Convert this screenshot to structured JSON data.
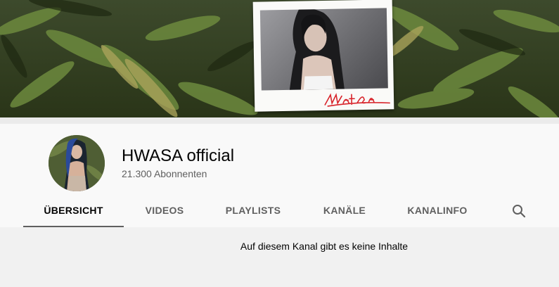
{
  "channel": {
    "name": "HWASA official",
    "subscribers": "21.300 Abonnenten",
    "banner_signature": "HWASA"
  },
  "tabs": [
    {
      "label": "ÜBERSICHT",
      "active": true
    },
    {
      "label": "VIDEOS",
      "active": false
    },
    {
      "label": "PLAYLISTS",
      "active": false
    },
    {
      "label": "KANÄLE",
      "active": false
    },
    {
      "label": "KANALINFO",
      "active": false
    }
  ],
  "search_icon": "search-icon",
  "content": {
    "empty_message": "Auf diesem Kanal gibt es keine Inhalte"
  },
  "colors": {
    "header_bg": "#f9f9f9",
    "content_bg": "#f1f1f1",
    "active_tab_indicator": "#606060",
    "signature_red": "#d8232a"
  }
}
